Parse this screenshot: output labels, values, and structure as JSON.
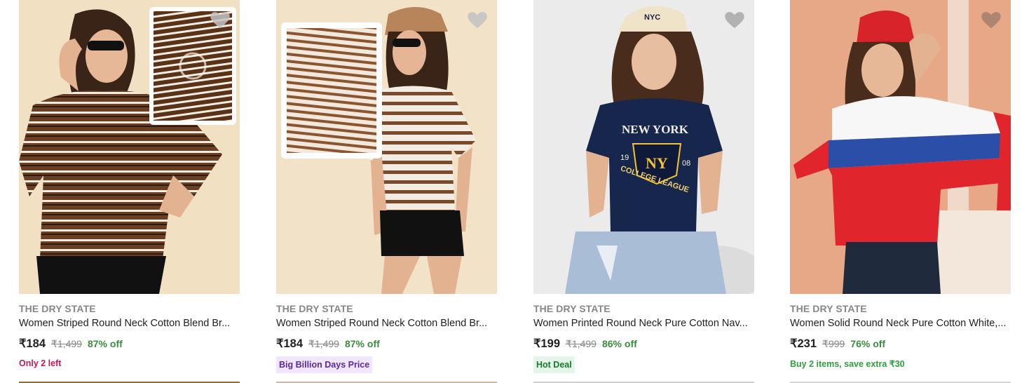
{
  "products": [
    {
      "brand": "THE DRY STATE",
      "title": "Women Striped Round Neck Cotton Blend Br...",
      "price": "₹184",
      "mrp": "₹1,499",
      "discount": "87% off",
      "tag": "Only 2 left",
      "tag_color": "#c2185b",
      "tag_bg": "",
      "image_desc_icon": "striped-tshirt-photo"
    },
    {
      "brand": "THE DRY STATE",
      "title": "Women Striped Round Neck Cotton Blend Br...",
      "price": "₹184",
      "mrp": "₹1,499",
      "discount": "87% off",
      "tag": "Big Billion Days Price",
      "tag_color": "#6a1b9a",
      "tag_bg": "#f3e8ff",
      "image_desc_icon": "striped-tshirt-photo"
    },
    {
      "brand": "THE DRY STATE",
      "title": "Women Printed Round Neck Pure Cotton Nav...",
      "price": "₹199",
      "mrp": "₹1,499",
      "discount": "86% off",
      "tag": "Hot Deal",
      "tag_color": "#1b7a2e",
      "tag_bg": "#e6f6ea",
      "image_desc_icon": "printed-tshirt-photo"
    },
    {
      "brand": "THE DRY STATE",
      "title": "Women Solid Round Neck Pure Cotton White,...",
      "price": "₹231",
      "mrp": "₹999",
      "discount": "76% off",
      "tag": "Buy 2 items, save extra ₹30",
      "tag_color": "#2e9e3e",
      "tag_bg": "",
      "image_desc_icon": "colorblock-tshirt-photo"
    }
  ],
  "wishlist_icon": "heart-icon",
  "colors": {
    "discount_green": "#388e3c",
    "muted_grey": "#878787",
    "text_dark": "#212121"
  }
}
